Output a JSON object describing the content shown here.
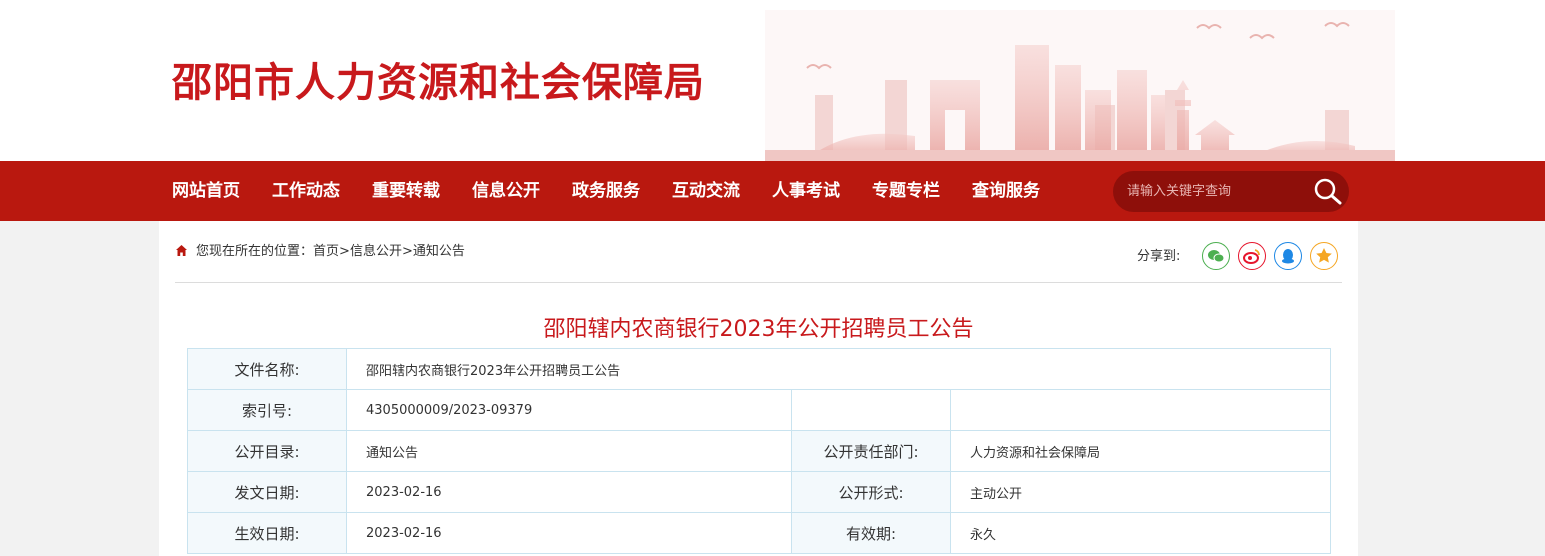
{
  "site": {
    "title": "邵阳市人力资源和社会保障局"
  },
  "nav": {
    "items": [
      "网站首页",
      "工作动态",
      "重要转载",
      "信息公开",
      "政务服务",
      "互动交流",
      "人事考试",
      "专题专栏",
      "查询服务"
    ],
    "search_placeholder": "请输入关键字查询"
  },
  "breadcrumb": {
    "prefix": "您现在所在的位置：",
    "items": [
      "首页",
      "信息公开",
      "通知公告"
    ],
    "separator": ">"
  },
  "share": {
    "label": "分享到:",
    "buttons": [
      {
        "name": "wechat-icon",
        "color": "#4caf50"
      },
      {
        "name": "weibo-icon",
        "color": "#e6162d"
      },
      {
        "name": "qq-icon",
        "color": "#1e88e5"
      },
      {
        "name": "qzone-icon",
        "color": "#f5a623"
      }
    ]
  },
  "article": {
    "title": "邵阳辖内农商银行2023年公开招聘员工公告"
  },
  "info": {
    "file_name_label": "文件名称:",
    "file_name": "邵阳辖内农商银行2023年公开招聘员工公告",
    "index_label": "索引号:",
    "index": "4305000009/2023-09379",
    "catalog_label": "公开目录:",
    "catalog": "通知公告",
    "dept_label": "公开责任部门:",
    "dept": "人力资源和社会保障局",
    "date_label": "发文日期:",
    "date": "2023-02-16",
    "form_label": "公开形式:",
    "form": "主动公开",
    "effective_label": "生效日期:",
    "effective": "2023-02-16",
    "validity_label": "有效期:",
    "validity": "永久"
  },
  "colors": {
    "brand_red": "#c8191c",
    "nav_red": "#b9180f",
    "search_bg": "#8e0f0a",
    "table_border": "#c9e3ef",
    "label_bg": "#f3f9fc"
  }
}
